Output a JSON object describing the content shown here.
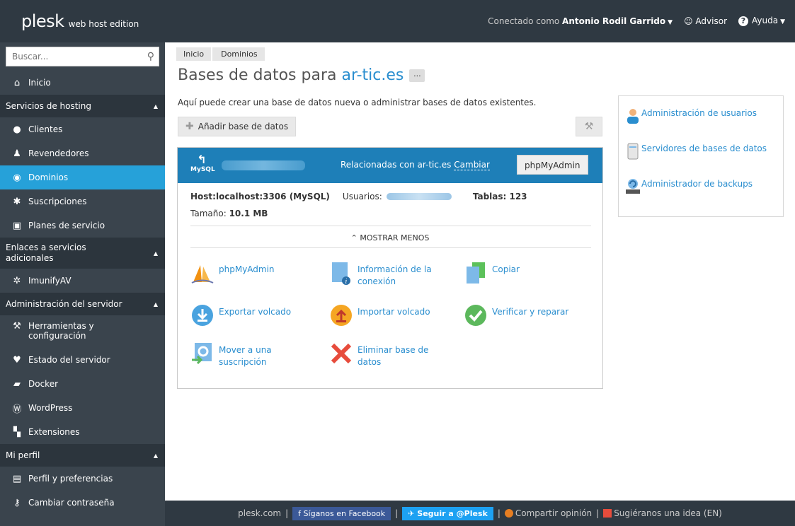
{
  "topbar": {
    "brand": "plesk",
    "edition": "web host edition",
    "connected_label": "Conectado como",
    "user_name": "Antonio Rodil Garrido",
    "advisor": "Advisor",
    "help": "Ayuda"
  },
  "sidebar": {
    "search_placeholder": "Buscar...",
    "home": "Inicio",
    "groups": {
      "hosting": "Servicios de hosting",
      "links": "Enlaces a servicios adicionales",
      "server": "Administración del servidor",
      "profile": "Mi perfil"
    },
    "items": {
      "clients": "Clientes",
      "resellers": "Revendedores",
      "domains": "Dominios",
      "subscriptions": "Suscripciones",
      "plans": "Planes de servicio",
      "imunify": "ImunifyAV",
      "tools": "Herramientas y configuración",
      "status": "Estado del servidor",
      "docker": "Docker",
      "wordpress": "WordPress",
      "extensions": "Extensiones",
      "prefs": "Perfil y preferencias",
      "password": "Cambiar contraseña"
    }
  },
  "breadcrumb": [
    "Inicio",
    "Dominios"
  ],
  "page": {
    "title": "Bases de datos para",
    "domain": "ar-tic.es",
    "dots": "...",
    "description": "Aquí puede crear una base de datos nueva o administrar bases de datos existentes.",
    "add_button": "Añadir base de datos"
  },
  "db": {
    "mysql_label": "MySQL",
    "related": "Relacionadas con ar-tic.es",
    "change": "Cambiar",
    "phpmyadmin_button": "phpMyAdmin",
    "host": "Host:localhost:3306 (MySQL)",
    "users_label": "Usuarios:",
    "tables": "Tablas: 123",
    "size_label": "Tamaño:",
    "size_value": "10.1 MB",
    "show_less": "MOSTRAR MENOS",
    "actions": {
      "phpmyadmin": "phpMyAdmin",
      "connection_info": "Información de la conexión",
      "copy": "Copiar",
      "export": "Exportar volcado",
      "import": "Importar volcado",
      "check": "Verificar y reparar",
      "move": "Mover a una suscripción",
      "delete": "Eliminar base de datos"
    }
  },
  "right_panel": {
    "users_admin": "Administración de usuarios",
    "db_servers": "Servidores de bases de datos",
    "backup_admin": "Administrador de backups"
  },
  "footer": {
    "site": "plesk.com",
    "facebook": "Síganos en Facebook",
    "twitter": "Seguir a @Plesk",
    "feedback": "Compartir opinión",
    "idea": "Sugiéranos una idea (EN)",
    "sep": "|"
  },
  "colors": {
    "topbar": "#2f3942",
    "sidebar": "#3a444d",
    "active": "#26a1d9",
    "link": "#2a8ecf",
    "db_header": "#1e7fb8"
  }
}
